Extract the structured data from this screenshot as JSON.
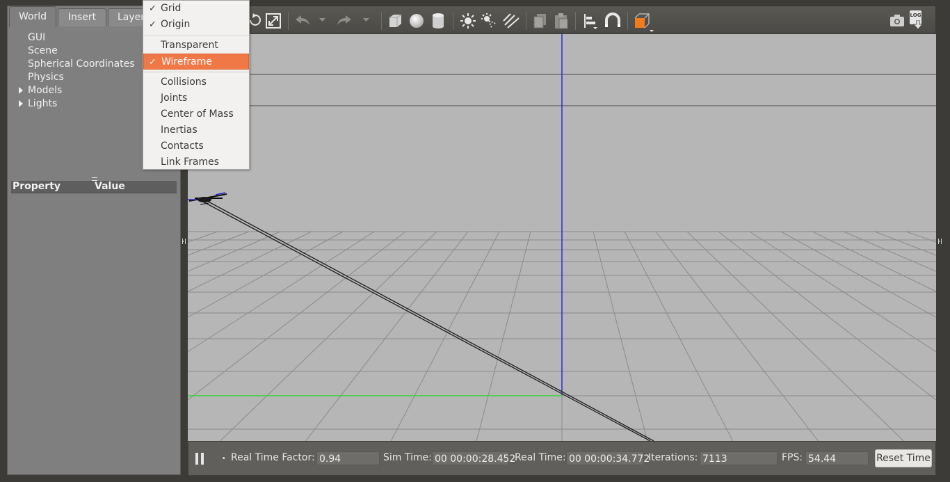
{
  "tabs": [
    {
      "label": "World"
    },
    {
      "label": "Insert"
    },
    {
      "label": "Layers"
    }
  ],
  "tree": {
    "items": [
      {
        "label": "GUI",
        "expandable": false
      },
      {
        "label": "Scene",
        "expandable": false
      },
      {
        "label": "Spherical Coordinates",
        "expandable": false
      },
      {
        "label": "Physics",
        "expandable": false
      },
      {
        "label": "Models",
        "expandable": true
      },
      {
        "label": "Lights",
        "expandable": true
      }
    ]
  },
  "properties": {
    "header_property": "Property",
    "header_value": "Value"
  },
  "menu": {
    "items": [
      {
        "label": "Grid",
        "checked": true,
        "highlighted": false
      },
      {
        "label": "Origin",
        "checked": true,
        "highlighted": false
      },
      {
        "label": "Transparent",
        "checked": false,
        "highlighted": false
      },
      {
        "label": "Wireframe",
        "checked": true,
        "highlighted": true
      },
      {
        "label": "Collisions",
        "checked": false,
        "highlighted": false
      },
      {
        "label": "Joints",
        "checked": false,
        "highlighted": false
      },
      {
        "label": "Center of Mass",
        "checked": false,
        "highlighted": false
      },
      {
        "label": "Inertias",
        "checked": false,
        "highlighted": false
      },
      {
        "label": "Contacts",
        "checked": false,
        "highlighted": false
      },
      {
        "label": "Link Frames",
        "checked": false,
        "highlighted": false
      }
    ],
    "check_glyph": "✓"
  },
  "toolbar": {
    "icons": [
      "rotate-icon",
      "scale-icon",
      "undo-icon",
      "undo-dropdown-icon",
      "redo-icon",
      "redo-dropdown-icon",
      "box-icon",
      "sphere-icon",
      "cylinder-icon",
      "point-light-icon",
      "spot-light-icon",
      "directional-light-icon",
      "copy-icon",
      "paste-icon",
      "align-icon",
      "snap-icon",
      "view-angle-icon",
      "screenshot-icon",
      "log-icon"
    ],
    "log_label": "LOG"
  },
  "status": {
    "real_time_factor_label": "Real Time Factor:",
    "real_time_factor": "0.94",
    "sim_time_label": "Sim Time:",
    "sim_time": "00 00:00:28.452",
    "real_time_label": "Real Time:",
    "real_time": "00 00:00:34.772",
    "iterations_label": "Iterations:",
    "iterations": "7113",
    "fps_label": "FPS:",
    "fps": "54.44",
    "reset_label": "Reset Time",
    "step_label": "."
  },
  "colors": {
    "menu_highlight": "#f07746",
    "viewport_bg": "#b6b6b6",
    "axis_z": "#2a2ad0",
    "axis_y": "#3ad23a",
    "view_angle_accent": "#f07c1e"
  }
}
